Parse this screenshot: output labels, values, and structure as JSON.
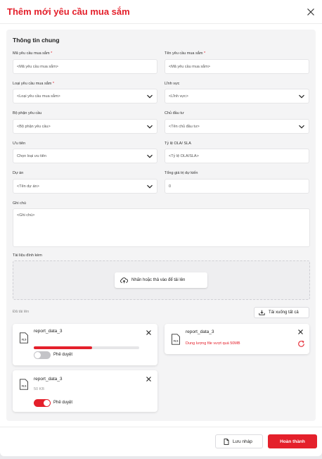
{
  "modal": {
    "title": "Thêm mới yêu cầu mua sắm"
  },
  "general": {
    "section_title": "Thông tin chung",
    "request_code": {
      "label": "Mã yêu cầu mua sắm",
      "required": "*",
      "placeholder": "<Mã yêu cầu mua sắm>"
    },
    "request_name": {
      "label": "Tên yêu cầu mua sắm",
      "required": "*",
      "placeholder": "<Mã yêu cầu mua sắm>"
    },
    "request_type": {
      "label": "Loại yêu cầu mua sắm",
      "required": "*",
      "value": "<Loại yêu cầu mua sắm>"
    },
    "field": {
      "label": "Lĩnh vực",
      "value": "<Lĩnh vực>"
    },
    "department": {
      "label": "Bộ phận yêu cầu",
      "value": "<Bộ phận yêu cầu>"
    },
    "investor": {
      "label": "Chủ đầu tư",
      "value": "<Tên chủ đầu tư>"
    },
    "priority": {
      "label": "Ưu tiên",
      "value": "Chọn loại ưu tiên"
    },
    "ola_sla": {
      "label": "Tỷ lệ OLA/ SLA",
      "placeholder": "<Tỷ lệ OLA/SLA>"
    },
    "project": {
      "label": "Dự án",
      "value": "<Tên dự án>"
    },
    "estimated_total": {
      "label": "Tổng giá trị dự kiến",
      "value": "0"
    },
    "notes": {
      "label": "Ghi chú",
      "placeholder": "<Ghi chú>"
    }
  },
  "attachments": {
    "label": "Tài liệu đính kèm",
    "upload_label": "Nhấn hoặc thả vào để tải lên",
    "uploaded_label": "Đã tải lên",
    "download_all_label": "Tải xuống tất cả",
    "file_type": "XLS",
    "files": [
      {
        "name": "report_data_3",
        "progress": 0.55,
        "approval_label": "Phê duyệt",
        "approved": false
      },
      {
        "name": "report_data_3",
        "error": "Dung lượng file vượt quá 50MB"
      },
      {
        "name": "report_data_3",
        "size": "50 KB",
        "approval_label": "Phê duyệt",
        "approved": true
      }
    ]
  },
  "footer": {
    "draft_label": "Lưu nháp",
    "submit_label": "Hoàn thành"
  },
  "colors": {
    "accent": "#e4202b",
    "toggle_off": "#c4c4c8",
    "panel": "#f4f4f5"
  }
}
